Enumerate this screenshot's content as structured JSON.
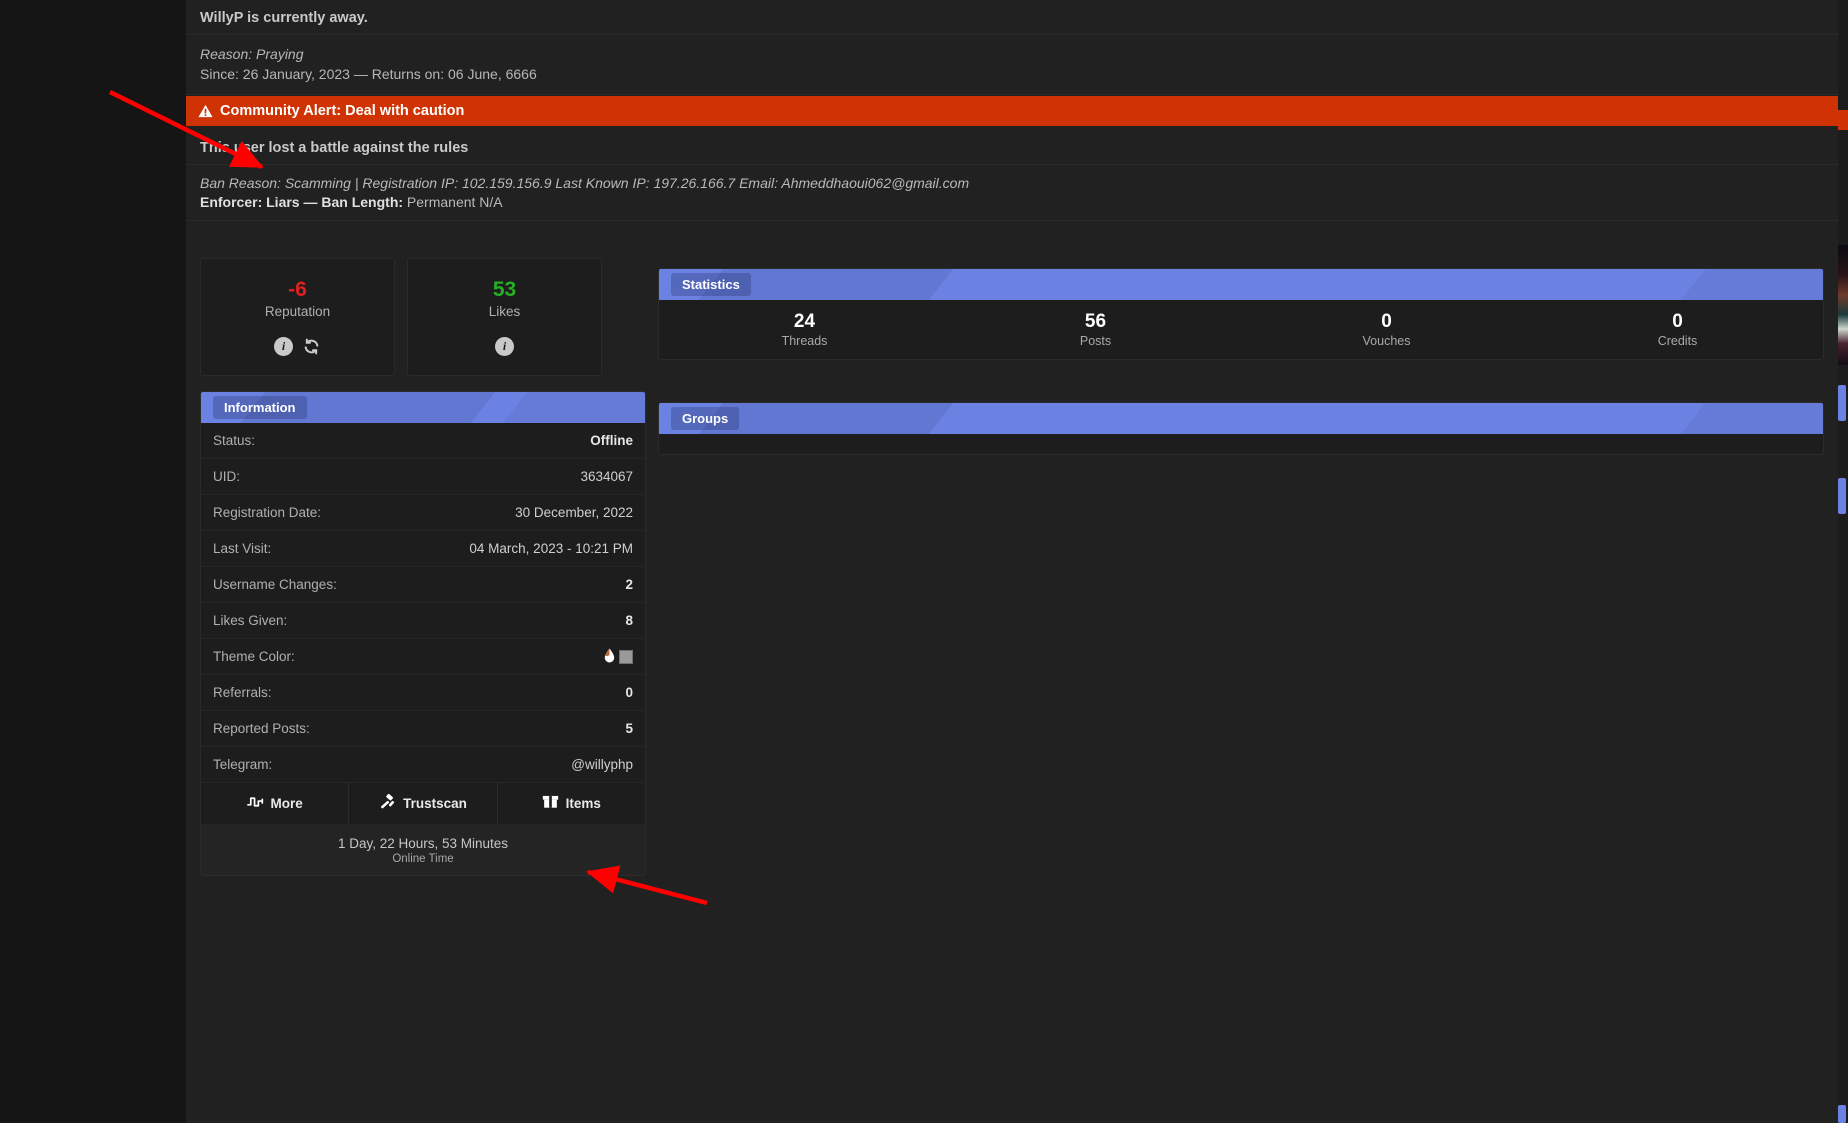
{
  "away": {
    "title": "WillyP is currently away.",
    "reason": "Reason: Praying",
    "since": "Since: 26 January, 2023 — Returns on: 06 June, 6666"
  },
  "alert": {
    "icon": "warning-triangle-icon",
    "text": "Community Alert: Deal with caution",
    "color": "#cf3303"
  },
  "ban": {
    "title": "This user lost a battle against the rules",
    "details": "Ban Reason: Scamming | Registration IP: 102.159.156.9 Last Known IP: 197.26.166.7 Email: Ahmeddhaoui062@gmail.com",
    "enforcer_label": "Enforcer:",
    "enforcer_value": "Liars",
    "separator": "—",
    "length_label": "Ban Length:",
    "length_value": "Permanent N/A"
  },
  "cards": [
    {
      "value": "-6",
      "label": "Reputation",
      "color": "#e02020",
      "icons": [
        "info-icon",
        "refresh-icon"
      ]
    },
    {
      "value": "53",
      "label": "Likes",
      "color": "#24b024",
      "icons": [
        "info-icon"
      ]
    }
  ],
  "information": {
    "header": "Information",
    "rows": [
      {
        "key": "Status:",
        "value": "Offline",
        "bold": true
      },
      {
        "key": "UID:",
        "value": "3634067",
        "bold": false
      },
      {
        "key": "Registration Date:",
        "value": "30 December, 2022",
        "bold": false
      },
      {
        "key": "Last Visit:",
        "value": "04 March, 2023 - 10:21 PM",
        "bold": false
      },
      {
        "key": "Username Changes:",
        "value": "2",
        "bold": true
      },
      {
        "key": "Likes Given:",
        "value": "8",
        "bold": true
      },
      {
        "key": "Theme Color:",
        "value": "",
        "bold": false,
        "swatch": "#9a9a9a"
      },
      {
        "key": "Referrals:",
        "value": "0",
        "bold": true
      },
      {
        "key": "Reported Posts:",
        "value": "5",
        "bold": true
      },
      {
        "key": "Telegram:",
        "value": "@willyphp",
        "bold": false
      }
    ],
    "buttons": [
      {
        "label": "More",
        "icon": "pulse-wave-icon"
      },
      {
        "label": "Trustscan",
        "icon": "gavel-icon"
      },
      {
        "label": "Items",
        "icon": "box-icon"
      }
    ],
    "online_time": "1 Day, 22 Hours, 53 Minutes",
    "online_time_label": "Online Time"
  },
  "statistics": {
    "header": "Statistics",
    "items": [
      {
        "value": "24",
        "label": "Threads"
      },
      {
        "value": "56",
        "label": "Posts"
      },
      {
        "value": "0",
        "label": "Vouches"
      },
      {
        "value": "0",
        "label": "Credits"
      }
    ]
  },
  "groups": {
    "header": "Groups",
    "items": []
  },
  "theme": {
    "panel_header": "#6b82e3",
    "alert": "#cf3303",
    "background": "#212121",
    "annotation_arrow": "#ff0000"
  }
}
